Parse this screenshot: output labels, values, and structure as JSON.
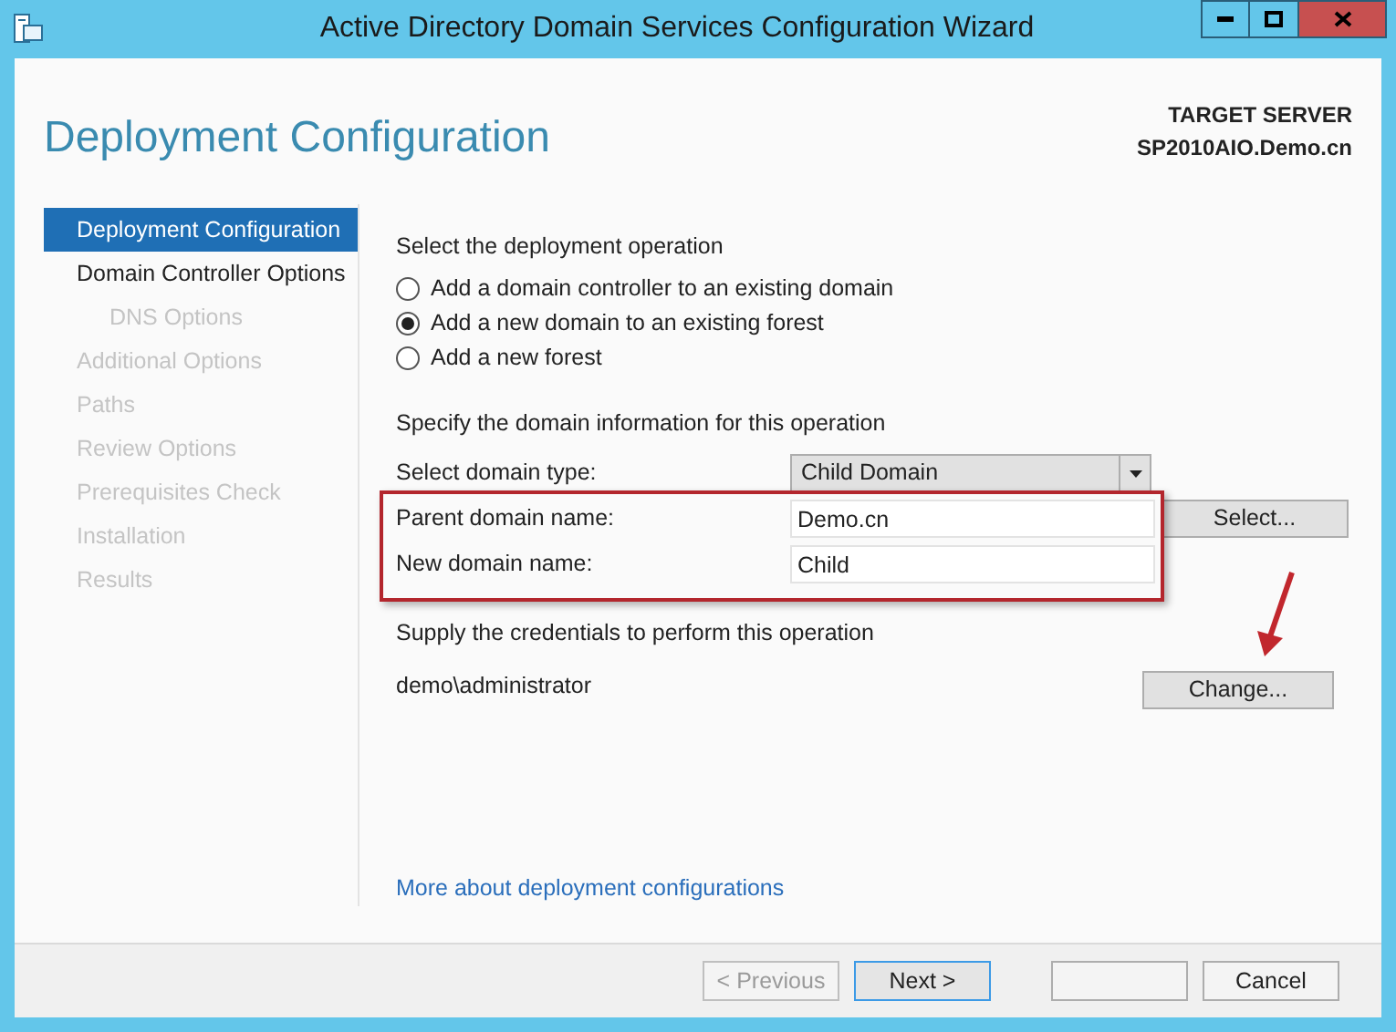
{
  "window": {
    "title": "Active Directory Domain Services Configuration Wizard"
  },
  "page_title": "Deployment Configuration",
  "target_server": {
    "label": "TARGET SERVER",
    "name": "SP2010AIO.Demo.cn"
  },
  "sidebar": {
    "items": [
      {
        "label": "Deployment Configuration",
        "selected": true,
        "disabled": false
      },
      {
        "label": "Domain Controller Options",
        "selected": false,
        "disabled": false,
        "children": [
          {
            "label": "DNS Options",
            "selected": false,
            "disabled": true
          }
        ]
      },
      {
        "label": "Additional Options",
        "selected": false,
        "disabled": true
      },
      {
        "label": "Paths",
        "selected": false,
        "disabled": true
      },
      {
        "label": "Review Options",
        "selected": false,
        "disabled": true
      },
      {
        "label": "Prerequisites Check",
        "selected": false,
        "disabled": true
      },
      {
        "label": "Installation",
        "selected": false,
        "disabled": true
      },
      {
        "label": "Results",
        "selected": false,
        "disabled": true
      }
    ]
  },
  "operation": {
    "heading": "Select the deployment operation",
    "options": [
      {
        "label": "Add a domain controller to an existing domain",
        "selected": false
      },
      {
        "label": "Add a new domain to an existing forest",
        "selected": true
      },
      {
        "label": "Add a new forest",
        "selected": false
      }
    ]
  },
  "domain_info": {
    "heading": "Specify the domain information for this operation",
    "fields": [
      {
        "kind": "dropdown",
        "label": "Select domain type:",
        "value": "Child Domain"
      },
      {
        "kind": "text",
        "label": "Parent domain name:",
        "value": "Demo.cn",
        "button": "Select..."
      },
      {
        "kind": "text",
        "label": "New domain name:",
        "value": "Child"
      }
    ]
  },
  "credentials": {
    "heading": "Supply the credentials to perform this operation",
    "user": "demo\\administrator",
    "button": "Change..."
  },
  "link": "More about deployment configurations",
  "buttons": [
    {
      "label": "< Previous",
      "disabled": true,
      "focused": false
    },
    {
      "label": "Next >",
      "disabled": false,
      "focused": true
    },
    {
      "disabled": false,
      "focused": false
    },
    {
      "label": "Cancel",
      "disabled": false,
      "focused": false
    }
  ]
}
